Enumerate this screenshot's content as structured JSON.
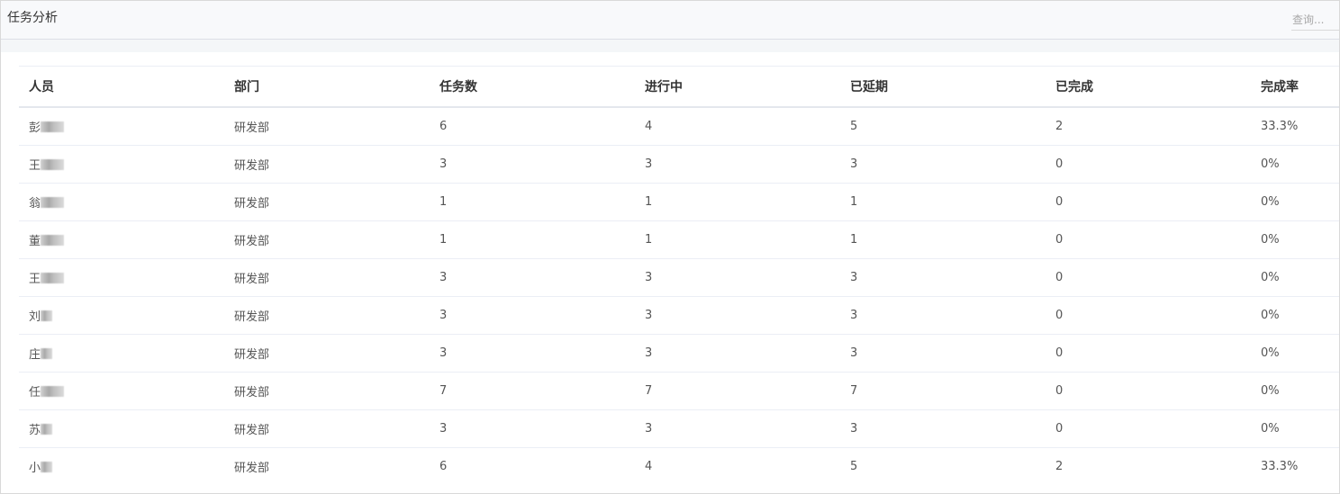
{
  "panel": {
    "title": "任务分析",
    "search_placeholder": "查询..."
  },
  "table": {
    "headers": {
      "name": "人员",
      "department": "部门",
      "total": "任务数",
      "in_progress": "进行中",
      "delayed": "已延期",
      "completed": "已完成",
      "completion_rate": "完成率"
    },
    "rows": [
      {
        "name_visible": "彭",
        "redacted_chars": 2,
        "department": "研发部",
        "total": "6",
        "in_progress": "4",
        "delayed": "5",
        "completed": "2",
        "completion_rate": "33.3%"
      },
      {
        "name_visible": "王",
        "redacted_chars": 2,
        "department": "研发部",
        "total": "3",
        "in_progress": "3",
        "delayed": "3",
        "completed": "0",
        "completion_rate": "0%"
      },
      {
        "name_visible": "翁",
        "redacted_chars": 2,
        "department": "研发部",
        "total": "1",
        "in_progress": "1",
        "delayed": "1",
        "completed": "0",
        "completion_rate": "0%"
      },
      {
        "name_visible": "董",
        "redacted_chars": 2,
        "department": "研发部",
        "total": "1",
        "in_progress": "1",
        "delayed": "1",
        "completed": "0",
        "completion_rate": "0%"
      },
      {
        "name_visible": "王",
        "redacted_chars": 2,
        "department": "研发部",
        "total": "3",
        "in_progress": "3",
        "delayed": "3",
        "completed": "0",
        "completion_rate": "0%"
      },
      {
        "name_visible": "刘",
        "redacted_chars": 1,
        "department": "研发部",
        "total": "3",
        "in_progress": "3",
        "delayed": "3",
        "completed": "0",
        "completion_rate": "0%"
      },
      {
        "name_visible": "庄",
        "redacted_chars": 1,
        "department": "研发部",
        "total": "3",
        "in_progress": "3",
        "delayed": "3",
        "completed": "0",
        "completion_rate": "0%"
      },
      {
        "name_visible": "任",
        "redacted_chars": 2,
        "department": "研发部",
        "total": "7",
        "in_progress": "7",
        "delayed": "7",
        "completed": "0",
        "completion_rate": "0%"
      },
      {
        "name_visible": "苏",
        "redacted_chars": 1,
        "department": "研发部",
        "total": "3",
        "in_progress": "3",
        "delayed": "3",
        "completed": "0",
        "completion_rate": "0%"
      },
      {
        "name_visible": "小",
        "redacted_chars": 1,
        "department": "研发部",
        "total": "6",
        "in_progress": "4",
        "delayed": "5",
        "completed": "2",
        "completion_rate": "33.3%"
      }
    ]
  }
}
